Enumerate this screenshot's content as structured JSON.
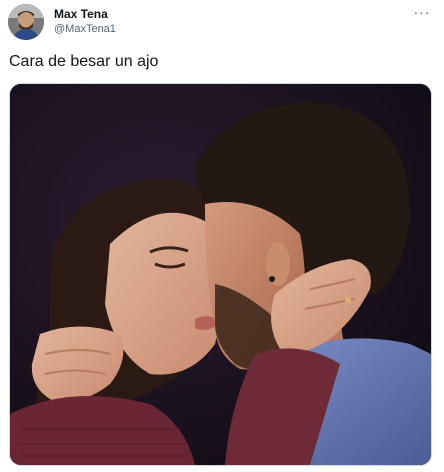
{
  "tweet": {
    "author": {
      "display_name": "Max Tena",
      "handle": "@MaxTena1",
      "avatar_icon": "user-avatar-photo"
    },
    "more_icon": "more-options-icon",
    "more_glyph": "···",
    "text": "Cara de besar un ajo",
    "media": {
      "kind": "photo",
      "icon": "tweet-photo"
    }
  },
  "colors": {
    "text_primary": "#0f1419",
    "text_secondary": "#536471",
    "border": "#cfd9de",
    "background": "#ffffff"
  }
}
